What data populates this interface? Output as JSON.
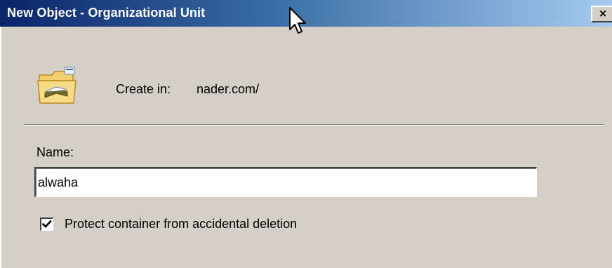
{
  "window": {
    "title": "New Object - Organizational Unit",
    "close_glyph": "×"
  },
  "header": {
    "icon": "folder-ou-icon",
    "create_in_label": "Create in:",
    "create_in_value": "nader.com/"
  },
  "form": {
    "name_label": "Name:",
    "name_value": "alwaha",
    "protect_checkbox": {
      "label": "Protect container from accidental deletion",
      "checked": true
    }
  },
  "colors": {
    "titlebar_start": "#0a246a",
    "titlebar_end": "#a6caf0",
    "dialog_background": "#d4d0c8"
  }
}
